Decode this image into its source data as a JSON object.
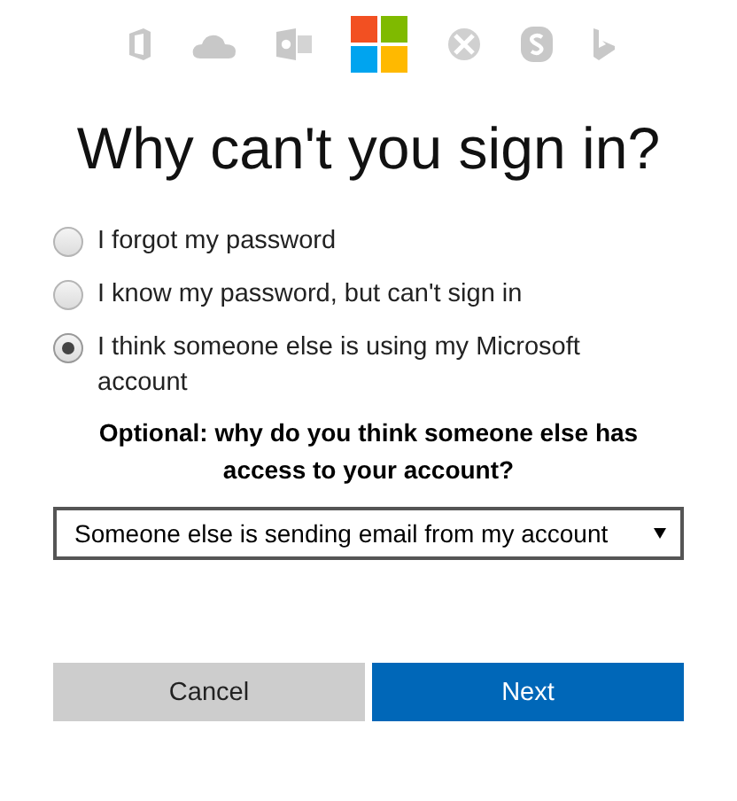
{
  "title": "Why can't you sign in?",
  "options": [
    {
      "label": "I forgot my password",
      "selected": false
    },
    {
      "label": "I know my password, but can't sign in",
      "selected": false
    },
    {
      "label": "I think someone else is using my Microsoft account",
      "selected": true
    }
  ],
  "optional_question": "Optional: why do you think someone else has access to your account?",
  "reason_dropdown": {
    "value": "Someone else is sending email from my account"
  },
  "buttons": [
    {
      "label": "Cancel",
      "kind": "secondary"
    },
    {
      "label": "Next",
      "kind": "primary"
    }
  ]
}
